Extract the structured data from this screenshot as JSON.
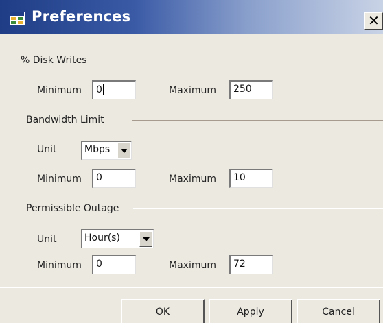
{
  "window": {
    "title": "Preferences",
    "close_label": "✕"
  },
  "disk_writes": {
    "label": "% Disk Writes",
    "min_label": "Minimum",
    "min_value": "0",
    "max_label": "Maximum",
    "max_value": "250"
  },
  "bandwidth": {
    "label": "Bandwidth Limit",
    "unit_label": "Unit",
    "unit_value": "Mbps",
    "min_label": "Minimum",
    "min_value": "0",
    "max_label": "Maximum",
    "max_value": "10"
  },
  "outage": {
    "label": "Permissible Outage",
    "unit_label": "Unit",
    "unit_value": "Hour(s)",
    "min_label": "Minimum",
    "min_value": "0",
    "max_label": "Maximum",
    "max_value": "72"
  },
  "buttons": {
    "ok": "OK",
    "apply": "Apply",
    "cancel": "Cancel"
  },
  "colors": {
    "title_gradient_start": "#1f3d86",
    "title_gradient_end": "#c9d3e6",
    "dialog_background": "#ece9e1",
    "separator": "#a79a8f"
  },
  "icons": {
    "title": "window-app-icon",
    "dropdown": "chevron-down-icon"
  }
}
